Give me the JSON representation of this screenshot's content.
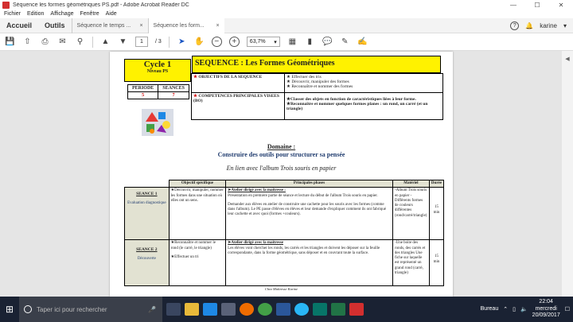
{
  "window": {
    "title": "Séquence les formes géométriques PS.pdf - Adobe Acrobat Reader DC",
    "controls": {
      "minimize": "—",
      "maximize": "☐",
      "close": "✕"
    }
  },
  "menu": [
    "Fichier",
    "Edition",
    "Affichage",
    "Fenêtre",
    "Aide"
  ],
  "nav": {
    "home": "Accueil",
    "tools": "Outils",
    "tabs": [
      {
        "label": "Séquence le temps ..."
      },
      {
        "label": "Séquence les form..."
      }
    ],
    "close_glyph": "×",
    "user": "karine"
  },
  "toolbar": {
    "page_current": "1",
    "page_total": "/ 3",
    "zoom": "63,7%"
  },
  "document": {
    "cycle": "Cycle 1",
    "niveau": "Niveau PS",
    "title": "SEQUENCE : Les Formes Géométriques",
    "periode_label": "PERIODE",
    "periode_value": "5",
    "seances_label": "SEANCES",
    "seances_value": "7",
    "objectifs_label": "OBJECTIFS DE LA SEQUENCE",
    "objectifs": [
      "Effectuer des tris",
      "Découvrir, manipuler des formes",
      "Reconnaître et nommer des formes"
    ],
    "competences_label": "COMPETENCES PRINCIPALES VISEES (BO)",
    "competences": [
      "Classer des objets en fonction de caractéristiques liées à leur forme.",
      "Reconnaître et nommer quelques formes planes : un rond, un carré (et un triangle)"
    ],
    "domaine": "Domaine :",
    "domaine_text": "Construire des outils pour structurer sa pensée",
    "lien": "En lien avec l'album Trois souris en papier",
    "table_headers": [
      "",
      "Objectif spécifique",
      "Principales phases",
      "Matériel",
      "Durée"
    ],
    "rows": [
      {
        "seance": "SEANCE 1",
        "type": "Evaluation diagnostique",
        "objectif": "Découvrir, manipuler, nommer les formes dans une situation où elles ont un sens.",
        "phase_title": "Atelier dirigé avec la maitresse :",
        "phase_text1": "Présentation en première partie de séance et lecture du début de l'album Trois souris en papier.",
        "phase_text2": "Demander aux élèves en atelier de construire une cachette pour les souris avec les formes (comme dans l'album). Le PE passe d'élèves en élèves et leur demande d'expliquer comment ils ont fabriqué leur cachette et avec quoi (formes +couleurs).",
        "materiel": "-Album Trois souris en papier - Différents formes de couleurs différentes (rond/carré/triangle)",
        "duree": "15 min"
      },
      {
        "seance": "SEANCE 2",
        "type": "Découverte",
        "objectif": "Reconnaître et nommer le rond (le carré, le triangle)",
        "objectif2": "Effectuer un tri",
        "phase_title": "Atelier dirigé avec la maitresse",
        "phase_text1": "Les élèves vont chercher les ronds, les carrés et les triangles et doivent les déposer sur la feuille correspondante, dans la forme géométrique, sans déposer et en couvrant toute la surface.",
        "phase_text2": "",
        "materiel": "-Une boite des ronds, des carrés et des triangles Une fiche sur laquelle est représenté un grand rond (carré, triangle)",
        "duree": "15 min"
      }
    ],
    "footer": "Chez Maîtresse Karine"
  },
  "taskbar": {
    "search_placeholder": "Taper ici pour rechercher",
    "bureau": "Bureau",
    "time": "22:04",
    "day": "mercredi",
    "date": "20/09/2017"
  },
  "colors": {
    "highlight": "#fff200",
    "table_header": "#e2e2d2",
    "taskbar": "#1a2233"
  }
}
